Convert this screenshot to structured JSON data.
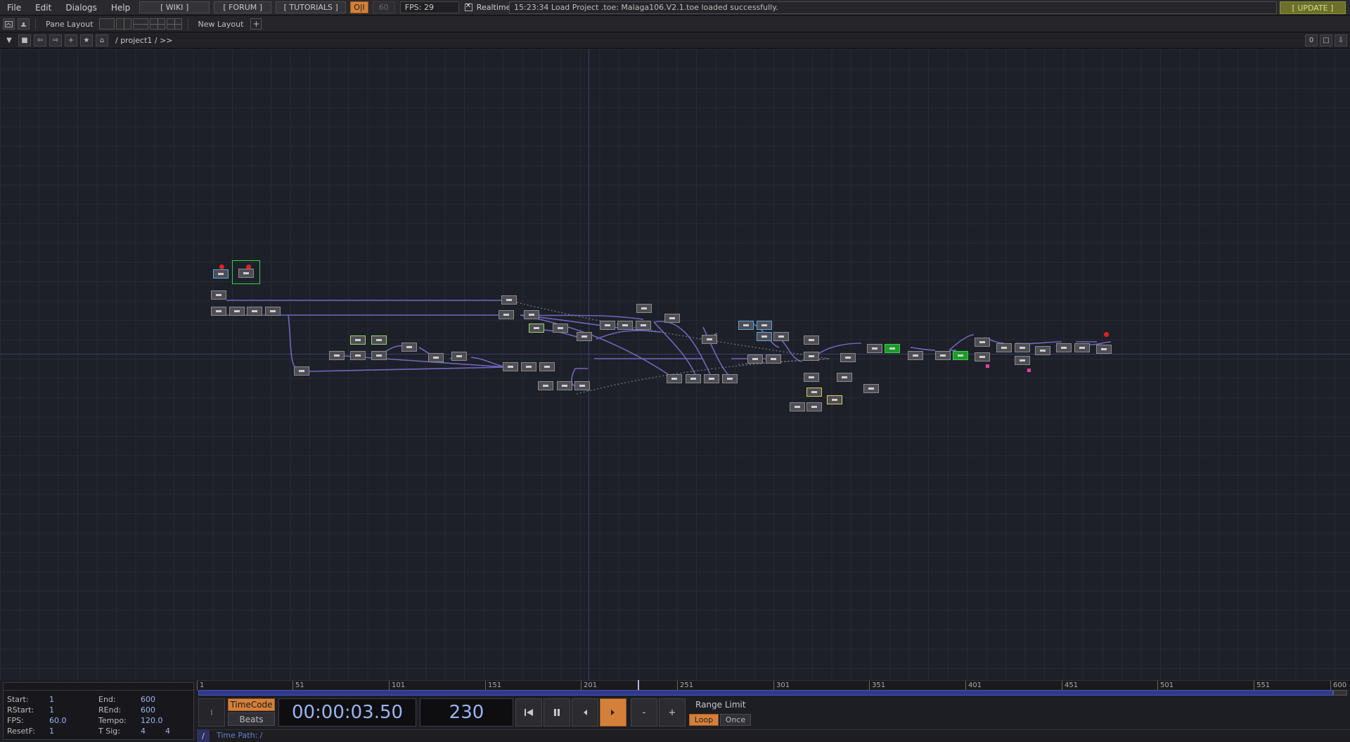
{
  "menu": {
    "items": [
      "File",
      "Edit",
      "Dialogs",
      "Help"
    ],
    "links": [
      "[ WIKI ]",
      "[ FORUM ]",
      "[ TUTORIALS ]"
    ],
    "oi_label": "O|I",
    "fps_cap": "60",
    "fps_readout": "FPS:  29",
    "realtime_label": "Realtime",
    "status_message": "15:23:34 Load Project .toe: Malaga106.V2.1.toe loaded successfully.",
    "update_label": "[ UPDATE ]"
  },
  "pane_bar": {
    "pane_layout_label": "Pane Layout",
    "new_layout_label": "New Layout",
    "plus": "+"
  },
  "path_bar": {
    "path": "/ project1 / >>",
    "right_value": "0"
  },
  "network": {
    "accent_line": "#7a6ed0",
    "grid_color": "#262a33",
    "axis_color": "#3c3f6a"
  },
  "timeline": {
    "ticks": [
      "1",
      "51",
      "101",
      "151",
      "201",
      "251",
      "301",
      "351",
      "401",
      "451",
      "501",
      "551",
      "600"
    ]
  },
  "settings": {
    "start_label": "Start:",
    "start_value": "1",
    "end_label": "End:",
    "end_value": "600",
    "rstart_label": "RStart:",
    "rstart_value": "1",
    "rend_label": "REnd:",
    "rend_value": "600",
    "fps_label": "FPS:",
    "fps_value": "60.0",
    "tempo_label": "Tempo:",
    "tempo_value": "120.0",
    "resetf_label": "ResetF:",
    "resetf_value": "1",
    "tsig_label": "T Sig:",
    "tsig_value_a": "4",
    "tsig_value_b": "4"
  },
  "transport": {
    "timecode_btn": "TimeCode",
    "beats_btn": "Beats",
    "timecode": "00:00:03.50",
    "frame": "230",
    "range_limit_label": "Range Limit",
    "loop_label": "Loop",
    "once_label": "Once",
    "minus": "-",
    "plus": "+",
    "side_key": "I"
  },
  "time_path": {
    "slash": "/",
    "label": "Time Path: /"
  }
}
